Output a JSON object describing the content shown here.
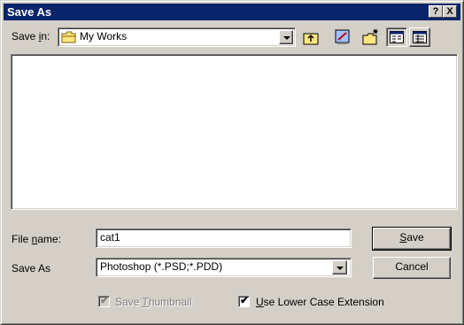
{
  "window": {
    "title": "Save As",
    "help_glyph": "?",
    "close_glyph": "X"
  },
  "save_in": {
    "label_pre": "Save ",
    "label_mnemonic": "i",
    "label_post": "n:",
    "value": "My Works",
    "icons": [
      "folder-icon",
      "up-one-level-icon",
      "desktop-icon",
      "new-folder-icon",
      "list-view-icon",
      "details-view-icon"
    ]
  },
  "file_list": {
    "items": []
  },
  "file_name": {
    "label_pre": "File ",
    "label_mnemonic": "n",
    "label_post": "ame:",
    "value": "cat1"
  },
  "save_as_type": {
    "label": "Save As",
    "value": "Photoshop (*.PSD;*.PDD)"
  },
  "buttons": {
    "save_mnemonic": "S",
    "save_rest": "ave",
    "cancel": "Cancel"
  },
  "options": {
    "save_thumbnail": {
      "label_pre": "Save ",
      "label_mnemonic": "T",
      "label_post": "humbnail",
      "checked": true,
      "enabled": false
    },
    "lower_case_ext": {
      "label_mnemonic": "U",
      "label_post": "se Lower Case Extension",
      "checked": true,
      "enabled": true
    }
  },
  "colors": {
    "title_bar": "#0a246a",
    "face": "#d4d0c8",
    "window_bg": "#ffffff"
  }
}
